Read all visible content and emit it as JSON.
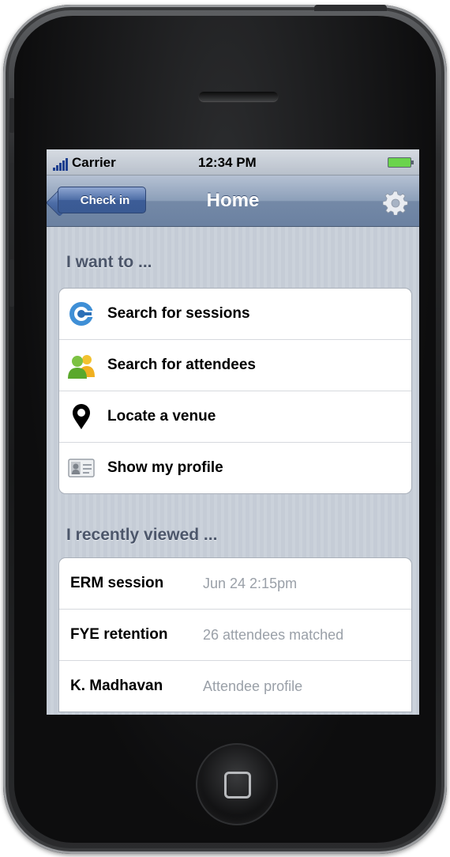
{
  "status_bar": {
    "carrier": "Carrier",
    "time": "12:34 PM"
  },
  "nav_bar": {
    "back_label": "Check in",
    "title": "Home",
    "settings_icon": "gear-icon"
  },
  "actions_section": {
    "header": "I want to ...",
    "items": [
      {
        "label": "Search for sessions",
        "icon": "search-sessions-icon"
      },
      {
        "label": "Search for attendees",
        "icon": "attendees-icon"
      },
      {
        "label": "Locate a venue",
        "icon": "location-pin-icon"
      },
      {
        "label": "Show my profile",
        "icon": "profile-card-icon"
      }
    ]
  },
  "recent_section": {
    "header": "I recently viewed ...",
    "items": [
      {
        "title": "ERM session",
        "detail": "Jun 24 2:15pm"
      },
      {
        "title": "FYE retention",
        "detail": "26 attendees matched"
      },
      {
        "title": "K. Madhavan",
        "detail": "Attendee profile"
      }
    ]
  },
  "colors": {
    "nav_bar": "#7489a7",
    "back_button": "#3c5c97",
    "section_header": "#4c566a",
    "detail_text": "#9aa0a8",
    "battery": "#6ad44c"
  }
}
